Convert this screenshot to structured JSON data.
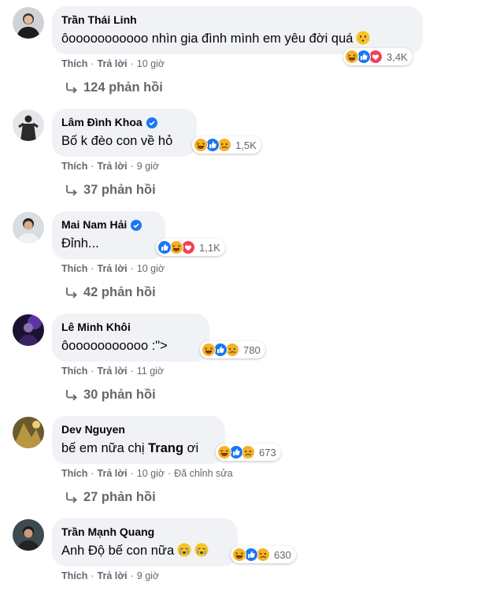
{
  "actions": {
    "like": "Thích",
    "reply": "Trả lời",
    "sep": "·"
  },
  "comments": [
    {
      "name": "Trần Thái Linh",
      "verified": false,
      "text": "ôooooooooooo nhìn gia đình mình em yêu đời quá",
      "emoji_after": "blush-emoji",
      "reactions": [
        "haha",
        "like",
        "love"
      ],
      "reaction_count": "3,4K",
      "time": "10 giờ",
      "edited": "",
      "replies": "124 phản hồi"
    },
    {
      "name": "Lâm Đình Khoa",
      "verified": true,
      "text": "Bố k đèo con về hỏ",
      "reactions": [
        "haha",
        "like",
        "sad"
      ],
      "reaction_count": "1,5K",
      "time": "9 giờ",
      "edited": "",
      "replies": "37 phản hồi"
    },
    {
      "name": "Mai Nam Hải",
      "verified": true,
      "text": "Đỉnh...",
      "reactions": [
        "like",
        "haha",
        "love"
      ],
      "reaction_count": "1,1K",
      "time": "10 giờ",
      "edited": "",
      "replies": "42 phản hồi"
    },
    {
      "name": "Lê Minh Khôi",
      "verified": false,
      "text": "ôooooooooooo :\">",
      "reactions": [
        "haha",
        "like",
        "sad"
      ],
      "reaction_count": "780",
      "time": "11 giờ",
      "edited": "",
      "replies": "30 phản hồi"
    },
    {
      "name": "Dev Nguyen",
      "verified": false,
      "text_before": "bế em nữa chị ",
      "text_bold": "Trang",
      "text_after": " ơi",
      "reactions": [
        "haha",
        "like",
        "sad"
      ],
      "reaction_count": "673",
      "time": "10 giờ",
      "edited": "Đã chỉnh sửa",
      "replies": "27 phản hồi"
    },
    {
      "name": "Trần Mạnh Quang",
      "verified": false,
      "text": "Anh Độ bế con nữa",
      "emoji_after": "cry-emoji",
      "reactions": [
        "haha",
        "like",
        "sad"
      ],
      "reaction_count": "630",
      "time": "9 giờ",
      "edited": "",
      "replies": ""
    }
  ],
  "colors": {
    "bubble": "#f0f2f5",
    "meta": "#65676b",
    "like": "#1877f2",
    "love": "#f33e58",
    "haha": "#f7b125",
    "verified": "#1877f2"
  }
}
